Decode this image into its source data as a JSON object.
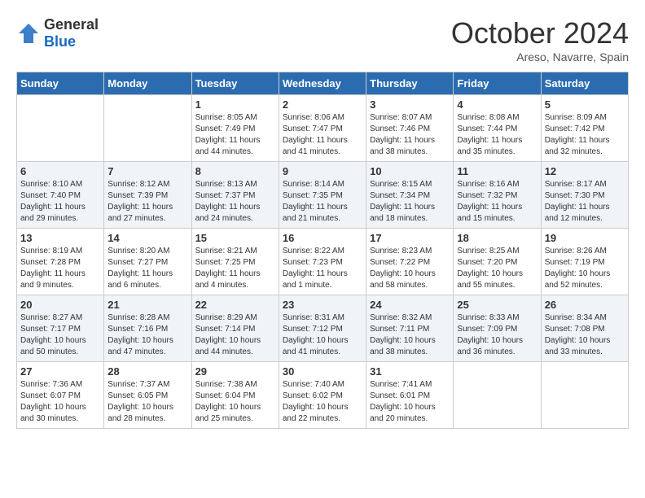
{
  "header": {
    "logo_general": "General",
    "logo_blue": "Blue",
    "month": "October 2024",
    "location": "Areso, Navarre, Spain"
  },
  "days_of_week": [
    "Sunday",
    "Monday",
    "Tuesday",
    "Wednesday",
    "Thursday",
    "Friday",
    "Saturday"
  ],
  "weeks": [
    [
      {
        "day": "",
        "sunrise": "",
        "sunset": "",
        "daylight": ""
      },
      {
        "day": "",
        "sunrise": "",
        "sunset": "",
        "daylight": ""
      },
      {
        "day": "1",
        "sunrise": "Sunrise: 8:05 AM",
        "sunset": "Sunset: 7:49 PM",
        "daylight": "Daylight: 11 hours and 44 minutes."
      },
      {
        "day": "2",
        "sunrise": "Sunrise: 8:06 AM",
        "sunset": "Sunset: 7:47 PM",
        "daylight": "Daylight: 11 hours and 41 minutes."
      },
      {
        "day": "3",
        "sunrise": "Sunrise: 8:07 AM",
        "sunset": "Sunset: 7:46 PM",
        "daylight": "Daylight: 11 hours and 38 minutes."
      },
      {
        "day": "4",
        "sunrise": "Sunrise: 8:08 AM",
        "sunset": "Sunset: 7:44 PM",
        "daylight": "Daylight: 11 hours and 35 minutes."
      },
      {
        "day": "5",
        "sunrise": "Sunrise: 8:09 AM",
        "sunset": "Sunset: 7:42 PM",
        "daylight": "Daylight: 11 hours and 32 minutes."
      }
    ],
    [
      {
        "day": "6",
        "sunrise": "Sunrise: 8:10 AM",
        "sunset": "Sunset: 7:40 PM",
        "daylight": "Daylight: 11 hours and 29 minutes."
      },
      {
        "day": "7",
        "sunrise": "Sunrise: 8:12 AM",
        "sunset": "Sunset: 7:39 PM",
        "daylight": "Daylight: 11 hours and 27 minutes."
      },
      {
        "day": "8",
        "sunrise": "Sunrise: 8:13 AM",
        "sunset": "Sunset: 7:37 PM",
        "daylight": "Daylight: 11 hours and 24 minutes."
      },
      {
        "day": "9",
        "sunrise": "Sunrise: 8:14 AM",
        "sunset": "Sunset: 7:35 PM",
        "daylight": "Daylight: 11 hours and 21 minutes."
      },
      {
        "day": "10",
        "sunrise": "Sunrise: 8:15 AM",
        "sunset": "Sunset: 7:34 PM",
        "daylight": "Daylight: 11 hours and 18 minutes."
      },
      {
        "day": "11",
        "sunrise": "Sunrise: 8:16 AM",
        "sunset": "Sunset: 7:32 PM",
        "daylight": "Daylight: 11 hours and 15 minutes."
      },
      {
        "day": "12",
        "sunrise": "Sunrise: 8:17 AM",
        "sunset": "Sunset: 7:30 PM",
        "daylight": "Daylight: 11 hours and 12 minutes."
      }
    ],
    [
      {
        "day": "13",
        "sunrise": "Sunrise: 8:19 AM",
        "sunset": "Sunset: 7:28 PM",
        "daylight": "Daylight: 11 hours and 9 minutes."
      },
      {
        "day": "14",
        "sunrise": "Sunrise: 8:20 AM",
        "sunset": "Sunset: 7:27 PM",
        "daylight": "Daylight: 11 hours and 6 minutes."
      },
      {
        "day": "15",
        "sunrise": "Sunrise: 8:21 AM",
        "sunset": "Sunset: 7:25 PM",
        "daylight": "Daylight: 11 hours and 4 minutes."
      },
      {
        "day": "16",
        "sunrise": "Sunrise: 8:22 AM",
        "sunset": "Sunset: 7:23 PM",
        "daylight": "Daylight: 11 hours and 1 minute."
      },
      {
        "day": "17",
        "sunrise": "Sunrise: 8:23 AM",
        "sunset": "Sunset: 7:22 PM",
        "daylight": "Daylight: 10 hours and 58 minutes."
      },
      {
        "day": "18",
        "sunrise": "Sunrise: 8:25 AM",
        "sunset": "Sunset: 7:20 PM",
        "daylight": "Daylight: 10 hours and 55 minutes."
      },
      {
        "day": "19",
        "sunrise": "Sunrise: 8:26 AM",
        "sunset": "Sunset: 7:19 PM",
        "daylight": "Daylight: 10 hours and 52 minutes."
      }
    ],
    [
      {
        "day": "20",
        "sunrise": "Sunrise: 8:27 AM",
        "sunset": "Sunset: 7:17 PM",
        "daylight": "Daylight: 10 hours and 50 minutes."
      },
      {
        "day": "21",
        "sunrise": "Sunrise: 8:28 AM",
        "sunset": "Sunset: 7:16 PM",
        "daylight": "Daylight: 10 hours and 47 minutes."
      },
      {
        "day": "22",
        "sunrise": "Sunrise: 8:29 AM",
        "sunset": "Sunset: 7:14 PM",
        "daylight": "Daylight: 10 hours and 44 minutes."
      },
      {
        "day": "23",
        "sunrise": "Sunrise: 8:31 AM",
        "sunset": "Sunset: 7:12 PM",
        "daylight": "Daylight: 10 hours and 41 minutes."
      },
      {
        "day": "24",
        "sunrise": "Sunrise: 8:32 AM",
        "sunset": "Sunset: 7:11 PM",
        "daylight": "Daylight: 10 hours and 38 minutes."
      },
      {
        "day": "25",
        "sunrise": "Sunrise: 8:33 AM",
        "sunset": "Sunset: 7:09 PM",
        "daylight": "Daylight: 10 hours and 36 minutes."
      },
      {
        "day": "26",
        "sunrise": "Sunrise: 8:34 AM",
        "sunset": "Sunset: 7:08 PM",
        "daylight": "Daylight: 10 hours and 33 minutes."
      }
    ],
    [
      {
        "day": "27",
        "sunrise": "Sunrise: 7:36 AM",
        "sunset": "Sunset: 6:07 PM",
        "daylight": "Daylight: 10 hours and 30 minutes."
      },
      {
        "day": "28",
        "sunrise": "Sunrise: 7:37 AM",
        "sunset": "Sunset: 6:05 PM",
        "daylight": "Daylight: 10 hours and 28 minutes."
      },
      {
        "day": "29",
        "sunrise": "Sunrise: 7:38 AM",
        "sunset": "Sunset: 6:04 PM",
        "daylight": "Daylight: 10 hours and 25 minutes."
      },
      {
        "day": "30",
        "sunrise": "Sunrise: 7:40 AM",
        "sunset": "Sunset: 6:02 PM",
        "daylight": "Daylight: 10 hours and 22 minutes."
      },
      {
        "day": "31",
        "sunrise": "Sunrise: 7:41 AM",
        "sunset": "Sunset: 6:01 PM",
        "daylight": "Daylight: 10 hours and 20 minutes."
      },
      {
        "day": "",
        "sunrise": "",
        "sunset": "",
        "daylight": ""
      },
      {
        "day": "",
        "sunrise": "",
        "sunset": "",
        "daylight": ""
      }
    ]
  ]
}
